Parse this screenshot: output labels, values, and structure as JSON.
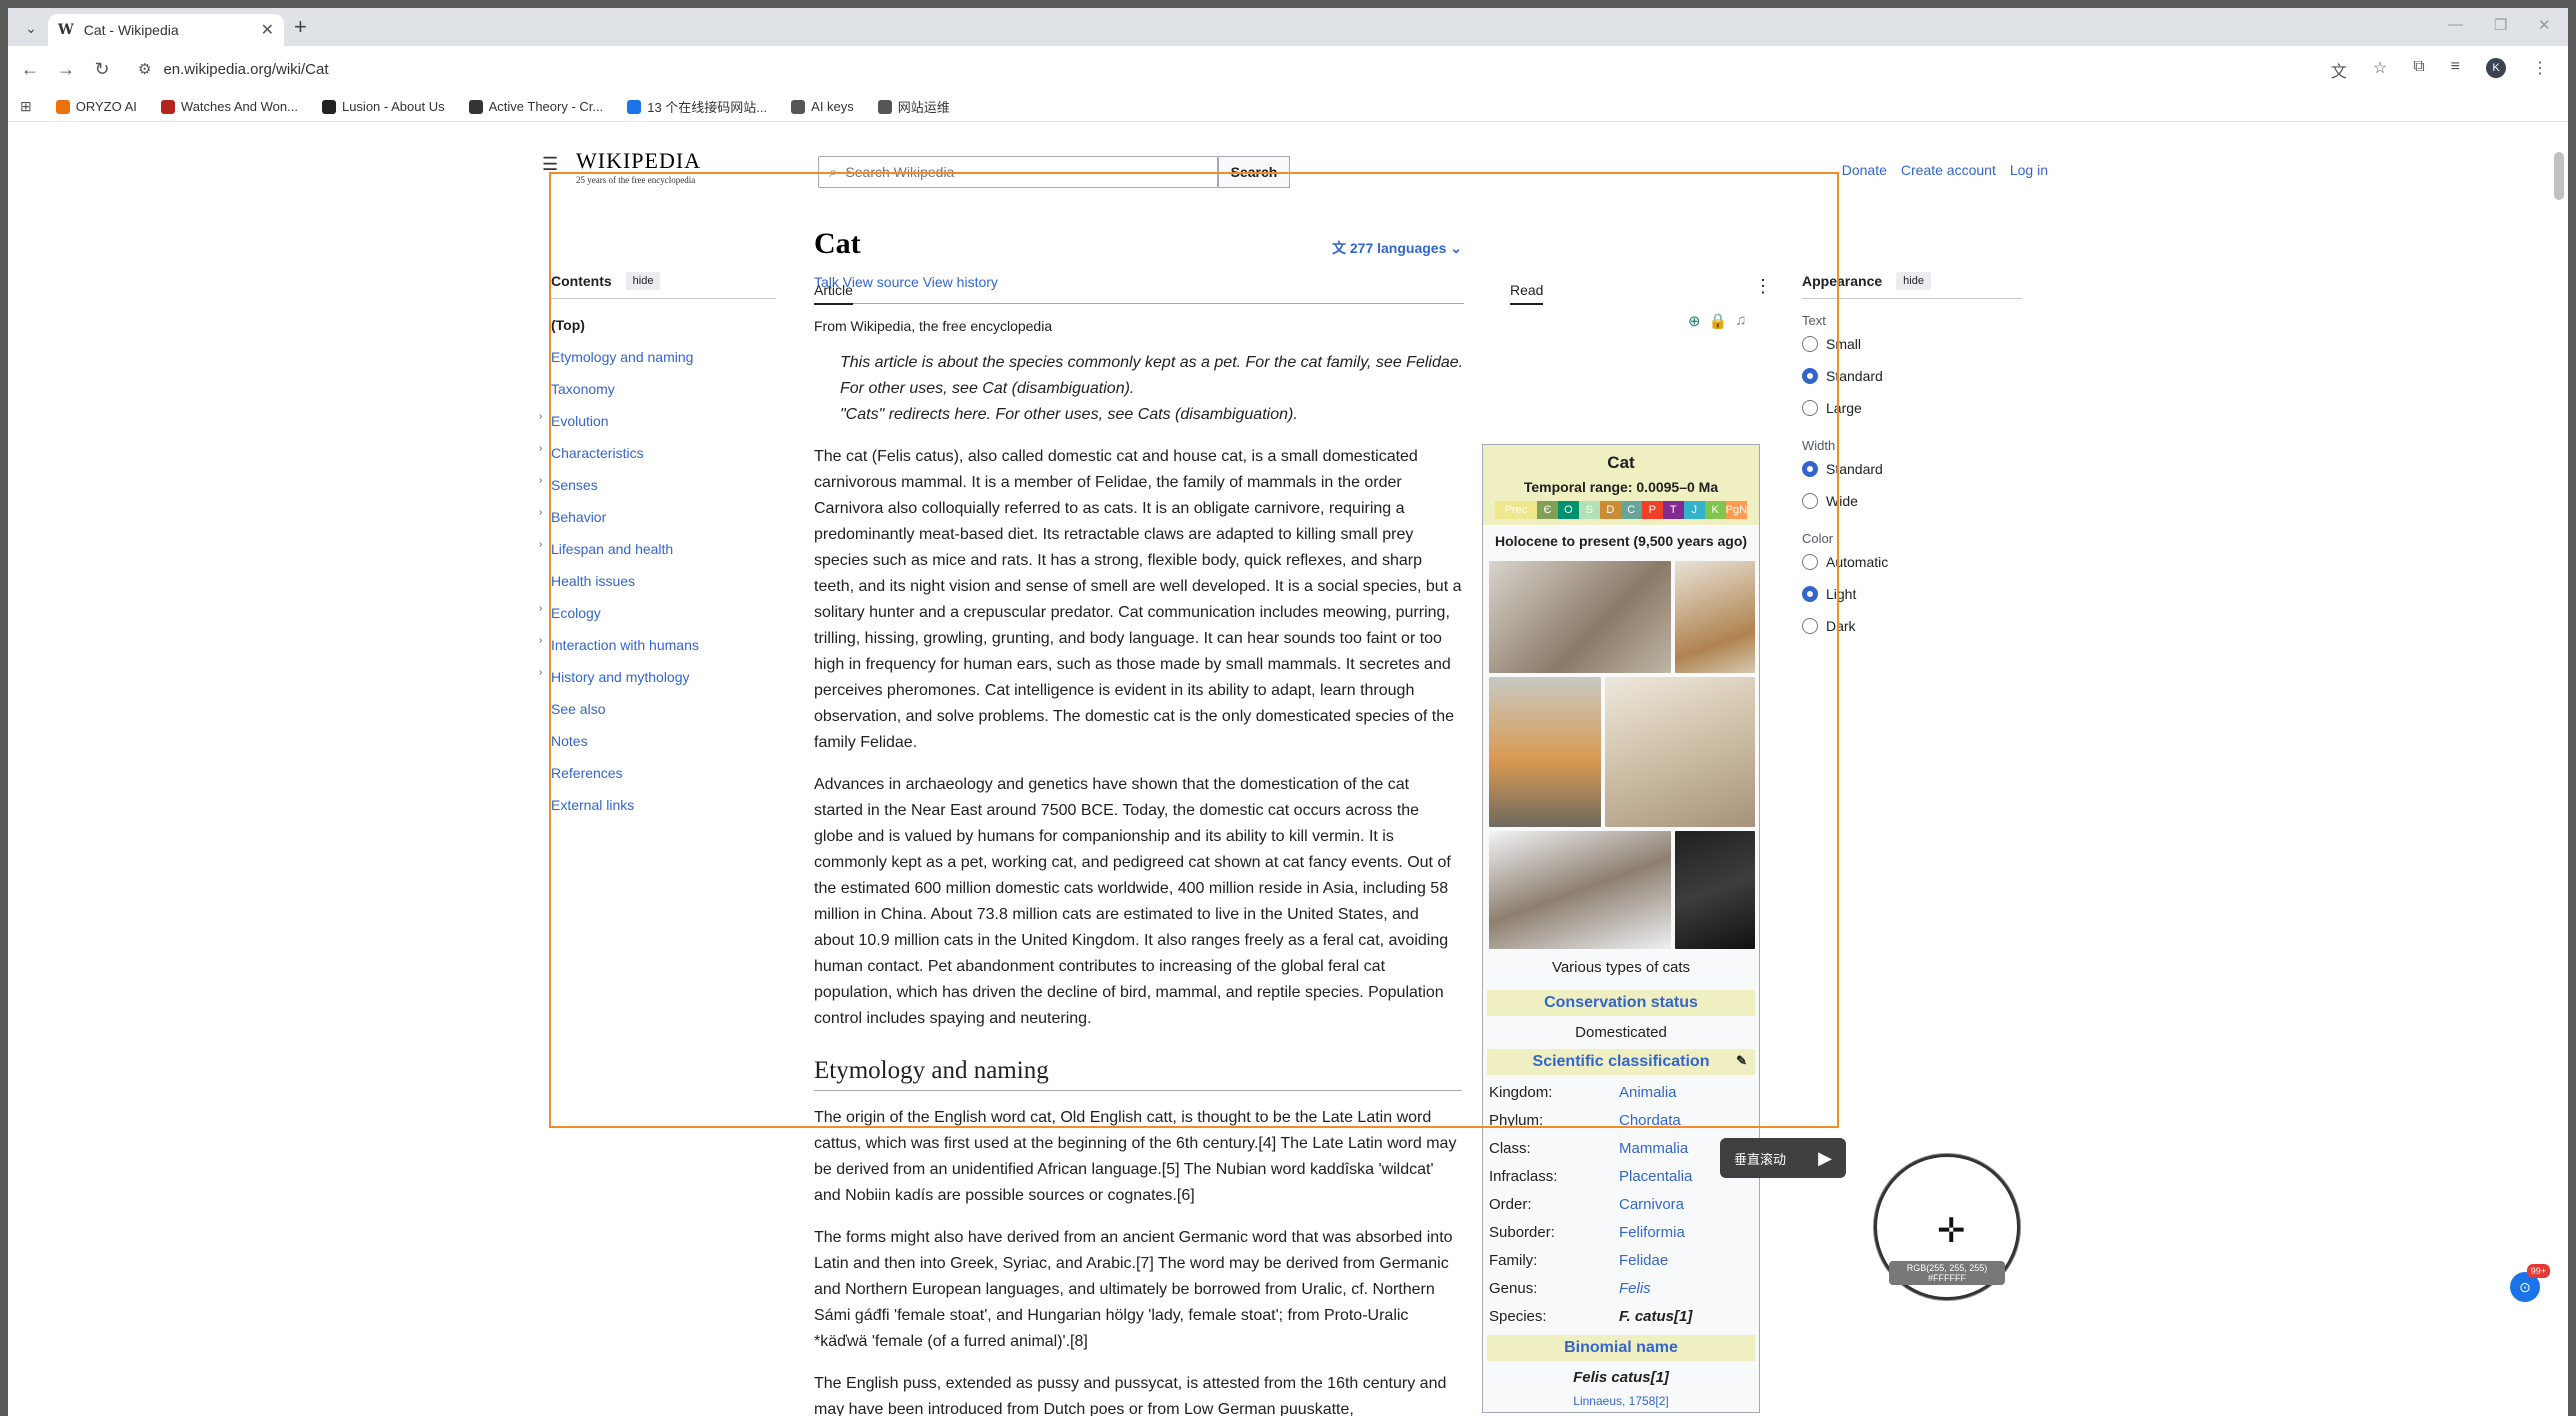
{
  "browser": {
    "tab_title": "Cat - Wikipedia",
    "tab_favicon": "W",
    "url": "en.wikipedia.org/wiki/Cat",
    "bookmarks": [
      {
        "label": "ORYZO AI",
        "color": "#e8710a"
      },
      {
        "label": "Watches And Won...",
        "color": "#b3261e"
      },
      {
        "label": "Lusion - About Us",
        "color": "#222222"
      },
      {
        "label": "Active Theory - Cr...",
        "color": "#333333"
      },
      {
        "label": "13 个在线接码网站...",
        "color": "#1a73e8"
      },
      {
        "label": "AI keys",
        "color": "#555555"
      },
      {
        "label": "网站运维",
        "color": "#555555"
      }
    ]
  },
  "header": {
    "wordmark": "WIKIPEDIA",
    "tagline": "25 years of the free encyclopedia",
    "search_placeholder": "Search Wikipedia",
    "search_button": "Search",
    "links": [
      "Donate",
      "Create account",
      "Log in"
    ]
  },
  "toc": {
    "title": "Contents",
    "hide": "hide",
    "items": [
      {
        "label": "(Top)",
        "expandable": false
      },
      {
        "label": "Etymology and naming",
        "expandable": false
      },
      {
        "label": "Taxonomy",
        "expandable": false
      },
      {
        "label": "Evolution",
        "expandable": true
      },
      {
        "label": "Characteristics",
        "expandable": true
      },
      {
        "label": "Senses",
        "expandable": true
      },
      {
        "label": "Behavior",
        "expandable": true
      },
      {
        "label": "Lifespan and health",
        "expandable": true
      },
      {
        "label": "Health issues",
        "expandable": false
      },
      {
        "label": "Ecology",
        "expandable": true
      },
      {
        "label": "Interaction with humans",
        "expandable": true
      },
      {
        "label": "History and mythology",
        "expandable": true
      },
      {
        "label": "See also",
        "expandable": false
      },
      {
        "label": "Notes",
        "expandable": false
      },
      {
        "label": "References",
        "expandable": false
      },
      {
        "label": "External links",
        "expandable": false
      }
    ]
  },
  "article": {
    "title": "Cat",
    "languages": "277 languages",
    "tabs": {
      "article": "Article",
      "talk": "Talk",
      "read": "Read",
      "view_source": "View source",
      "view_history": "View history"
    },
    "from": "From Wikipedia, the free encyclopedia",
    "hatnote1": "This article is about the species commonly kept as a pet. For the cat family, see Felidae. For other uses, see Cat (disambiguation).",
    "hatnote2": "\"Cats\" redirects here. For other uses, see Cats (disambiguation).",
    "p1": "The cat (Felis catus), also called domestic cat and house cat, is a small domesticated carnivorous mammal. It is a member of Felidae, the family of mammals in the order Carnivora also colloquially referred to as cats. It is an obligate carnivore, requiring a predominantly meat-based diet. Its retractable claws are adapted to killing small prey species such as mice and rats. It has a strong, flexible body, quick reflexes, and sharp teeth, and its night vision and sense of smell are well developed. It is a social species, but a solitary hunter and a crepuscular predator. Cat communication includes meowing, purring, trilling, hissing, growling, grunting, and body language. It can hear sounds too faint or too high in frequency for human ears, such as those made by small mammals. It secretes and perceives pheromones. Cat intelligence is evident in its ability to adapt, learn through observation, and solve problems. The domestic cat is the only domesticated species of the family Felidae.",
    "p2": "Advances in archaeology and genetics have shown that the domestication of the cat started in the Near East around 7500 BCE. Today, the domestic cat occurs across the globe and is valued by humans for companionship and its ability to kill vermin. It is commonly kept as a pet, working cat, and pedigreed cat shown at cat fancy events. Out of the estimated 600 million domestic cats worldwide, 400 million reside in Asia, including 58 million in China. About 73.8 million cats are estimated to live in the United States, and about 10.9 million cats in the United Kingdom. It also ranges freely as a feral cat, avoiding human contact. Pet abandonment contributes to increasing of the global feral cat population, which has driven the decline of bird, mammal, and reptile species. Population control includes spaying and neutering.",
    "h2": "Etymology and naming",
    "p3": "The origin of the English word cat, Old English catt, is thought to be the Late Latin word cattus, which was first used at the beginning of the 6th century.[4] The Late Latin word may be derived from an unidentified African language.[5] The Nubian word kaddîska 'wildcat' and Nobiin kadís are possible sources or cognates.[6]",
    "p4": "The forms might also have derived from an ancient Germanic word that was absorbed into Latin and then into Greek, Syriac, and Arabic.[7] The word may be derived from Germanic and Northern European languages, and ultimately be borrowed from Uralic, cf. Northern Sámi gáđfi 'female stoat', and Hungarian hölgy 'lady, female stoat'; from Proto-Uralic *käďwä 'female (of a furred animal)'.[8]",
    "p5": "The English puss, extended as pussy and pussycat, is attested from the 16th century and may have been introduced from Dutch poes or from Low German puuskatte,"
  },
  "infobox": {
    "title": "Cat",
    "range": "Temporal range: 0.0095–0 Ma",
    "timebar": [
      {
        "t": "Prec",
        "c": "#f0e68c"
      },
      {
        "t": "Є",
        "c": "#7fa056"
      },
      {
        "t": "O",
        "c": "#009270"
      },
      {
        "t": "S",
        "c": "#b3e1b6"
      },
      {
        "t": "D",
        "c": "#cb8c37"
      },
      {
        "t": "C",
        "c": "#67a599"
      },
      {
        "t": "P",
        "c": "#f04028"
      },
      {
        "t": "T",
        "c": "#812b92"
      },
      {
        "t": "J",
        "c": "#34b2c9"
      },
      {
        "t": "K",
        "c": "#7fc64e"
      },
      {
        "t": "PgN",
        "c": "#fd9a52"
      }
    ],
    "holocene": "Holocene to present (9,500 years ago)",
    "caption": "Various types of cats",
    "conservation_title": "Conservation status",
    "conservation": "Domesticated",
    "classification_title": "Scientific classification",
    "rows": [
      {
        "k": "Kingdom:",
        "v": "Animalia"
      },
      {
        "k": "Phylum:",
        "v": "Chordata"
      },
      {
        "k": "Class:",
        "v": "Mammalia"
      },
      {
        "k": "Infraclass:",
        "v": "Placentalia"
      },
      {
        "k": "Order:",
        "v": "Carnivora"
      },
      {
        "k": "Suborder:",
        "v": "Feliformia"
      },
      {
        "k": "Family:",
        "v": "Felidae"
      },
      {
        "k": "Genus:",
        "v": "Felis"
      },
      {
        "k": "Species:",
        "v": "F. catus[1]"
      }
    ],
    "binomial_title": "Binomial name",
    "binomial": "Felis catus[1]",
    "authority": "Linnaeus, 1758[2]"
  },
  "appearance": {
    "title": "Appearance",
    "hide": "hide",
    "groups": [
      {
        "label": "Text",
        "options": [
          {
            "l": "Small",
            "on": false
          },
          {
            "l": "Standard",
            "on": true
          },
          {
            "l": "Large",
            "on": false
          }
        ]
      },
      {
        "label": "Width",
        "options": [
          {
            "l": "Standard",
            "on": true
          },
          {
            "l": "Wide",
            "on": false
          }
        ]
      },
      {
        "label": "Color",
        "options": [
          {
            "l": "Automatic",
            "on": false
          },
          {
            "l": "Light",
            "on": true
          },
          {
            "l": "Dark",
            "on": false
          }
        ]
      }
    ]
  },
  "overlay": {
    "scroll_label": "垂直滚动",
    "picker_rgb": "RGB(255, 255, 255)",
    "picker_hex": "#FFFFFF",
    "badge": "99+"
  }
}
